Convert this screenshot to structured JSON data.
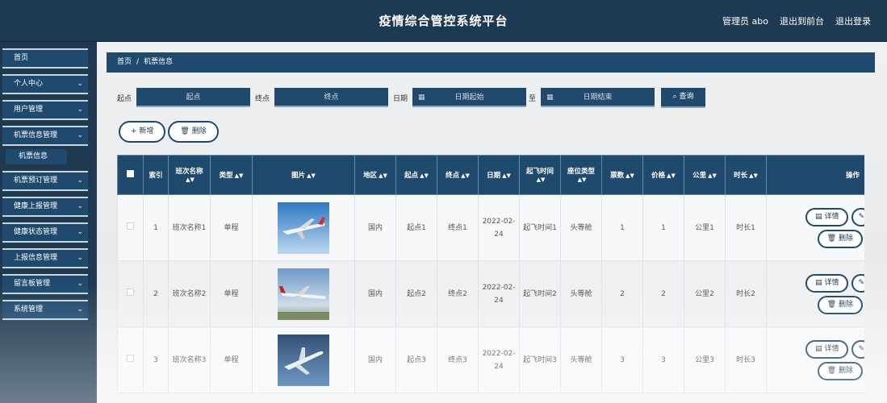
{
  "header": {
    "title": "疫情综合管控系统平台",
    "admin": "管理员 abo",
    "back_front": "退出到前台",
    "logout": "退出登录"
  },
  "sidebar": {
    "items": [
      {
        "label": "首页"
      },
      {
        "label": "个人中心"
      },
      {
        "label": "用户管理"
      },
      {
        "label": "机票信息管理"
      },
      {
        "label": "机票信息"
      },
      {
        "label": "机票预订管理"
      },
      {
        "label": "健康上报管理"
      },
      {
        "label": "健康状态管理"
      },
      {
        "label": "上报信息管理"
      },
      {
        "label": "留言板管理"
      },
      {
        "label": "系统管理"
      }
    ]
  },
  "breadcrumb": {
    "home": "首页",
    "sep": "/",
    "current": "机票信息"
  },
  "filter": {
    "origin_label": "起点",
    "origin_placeholder": "起点",
    "dest_label": "终点",
    "dest_placeholder": "终点",
    "date_label": "日期",
    "date_start_placeholder": "日期起始",
    "to_label": "至",
    "date_end_placeholder": "日期结束",
    "query_label": "查询"
  },
  "actions": {
    "add_label": "新增",
    "delete_label": "删除"
  },
  "table": {
    "headers": {
      "index": "索引",
      "flight_name": "班次名称",
      "type": "类型",
      "image": "图片",
      "region": "地区",
      "origin": "起点",
      "dest": "终点",
      "date": "日期",
      "departure": "起飞时间",
      "seat": "座位类型",
      "tickets": "票数",
      "price": "价格",
      "km": "公里",
      "duration": "时长",
      "ops": "操作"
    },
    "op_detail": "详情",
    "op_delete": "删除",
    "rows": [
      {
        "index": "1",
        "flight_name": "班次名称1",
        "type": "单程",
        "region": "国内",
        "origin": "起点1",
        "dest": "终点1",
        "date": "2022-02-24",
        "departure": "起飞时间1",
        "seat": "头等舱",
        "tickets": "1",
        "price": "1",
        "km": "公里1",
        "duration": "时长1"
      },
      {
        "index": "2",
        "flight_name": "班次名称2",
        "type": "单程",
        "region": "国内",
        "origin": "起点2",
        "dest": "终点2",
        "date": "2022-02-24",
        "departure": "起飞时间2",
        "seat": "头等舱",
        "tickets": "2",
        "price": "2",
        "km": "公里2",
        "duration": "时长2"
      },
      {
        "index": "3",
        "flight_name": "班次名称3",
        "type": "单程",
        "region": "国内",
        "origin": "起点3",
        "dest": "终点3",
        "date": "2022-02-24",
        "departure": "起飞时间3",
        "seat": "头等舱",
        "tickets": "3",
        "price": "3",
        "km": "公里3",
        "duration": "时长3"
      }
    ]
  },
  "colors": {
    "primary": "#1f4a6e",
    "header": "#1e3a52",
    "sidebar": "#1f3a50"
  }
}
